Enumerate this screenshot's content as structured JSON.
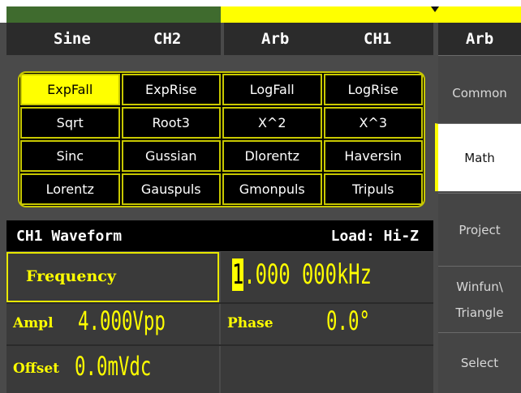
{
  "channels": {
    "ch2": {
      "waveform": "Sine",
      "name": "CH2"
    },
    "ch1": {
      "waveform": "Arb",
      "name": "CH1"
    }
  },
  "colors": {
    "accent": "#ffff00",
    "ch2_indicator": "#3f6b2e",
    "background": "#4a4a4a"
  },
  "menu": {
    "title": "Arb",
    "items": [
      {
        "label": "Common"
      },
      {
        "label": "Math",
        "active": true
      },
      {
        "label": "Project"
      },
      {
        "label_line1": "Winfun\\",
        "label_line2": "Triangle"
      },
      {
        "label": "Select"
      }
    ]
  },
  "grid": {
    "cells": [
      "ExpFall",
      "ExpRise",
      "LogFall",
      "LogRise",
      "Sqrt",
      "Root3",
      "X^2",
      "X^3",
      "Sinc",
      "Gussian",
      "Dlorentz",
      "Haversin",
      "Lorentz",
      "Gauspuls",
      "Gmonpuls",
      "Tripuls"
    ],
    "selected": "ExpFall"
  },
  "waveform_bar": {
    "title": "CH1 Waveform",
    "load": "Load: Hi-Z"
  },
  "params": {
    "frequency": {
      "label": "Frequency",
      "cursor_digit": "1",
      "value_rest": ".000 000kHz"
    },
    "ampl": {
      "label": "Ampl",
      "value": "4.000Vpp"
    },
    "phase": {
      "label": "Phase",
      "value": "0.0°"
    },
    "offset": {
      "label": "Offset",
      "value": "0.0mVdc"
    }
  }
}
